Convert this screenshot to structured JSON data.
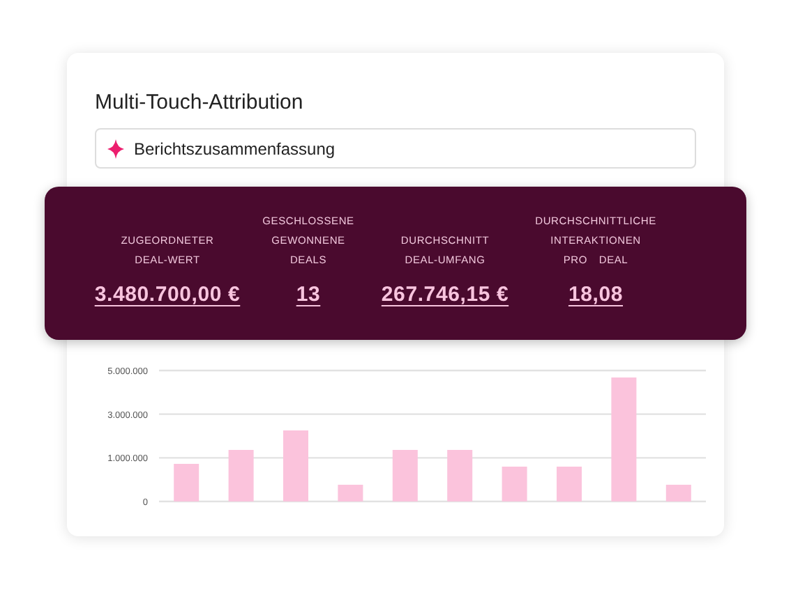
{
  "title": "Multi-Touch-Attribution",
  "summary_field": {
    "value": "Berichtszusammenfassung"
  },
  "metrics": [
    {
      "label": "ZUGEORDNETER DEAL-WERT",
      "value": "3.480.700,00 €"
    },
    {
      "label": "GESCHLOSSENE GEWONNENE DEALS",
      "value": "13"
    },
    {
      "label": "DURCHSCHNITT DEAL-UMFANG",
      "value": "267.746,15 €"
    },
    {
      "label": "DURCHSCHNITTLICHE INTERAKTIONEN PRO DEAL",
      "value": "18,08"
    }
  ],
  "chart": {
    "y_axis_labels": [
      "5.000.000",
      "3.000.000",
      "1.000.000",
      "0"
    ]
  }
}
